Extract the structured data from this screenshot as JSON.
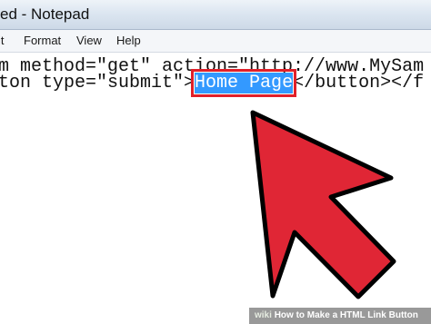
{
  "window": {
    "title": "ed - Notepad"
  },
  "menu": {
    "items": [
      {
        "label": "it"
      },
      {
        "label": "Format"
      },
      {
        "label": "View"
      },
      {
        "label": "Help"
      }
    ]
  },
  "editor": {
    "line1": "m method=\"get\" action=\"http://www.MySam",
    "line2_before": "ton type=\"submit\">",
    "line2_selected": "Home Page",
    "line2_after": "</button></f"
  },
  "colors": {
    "selection": "#3399ff",
    "highlight_box": "#e0202a",
    "arrow": "#e02635"
  },
  "watermark": {
    "logo": "wiki",
    "text": "How to Make a HTML Link Button"
  }
}
